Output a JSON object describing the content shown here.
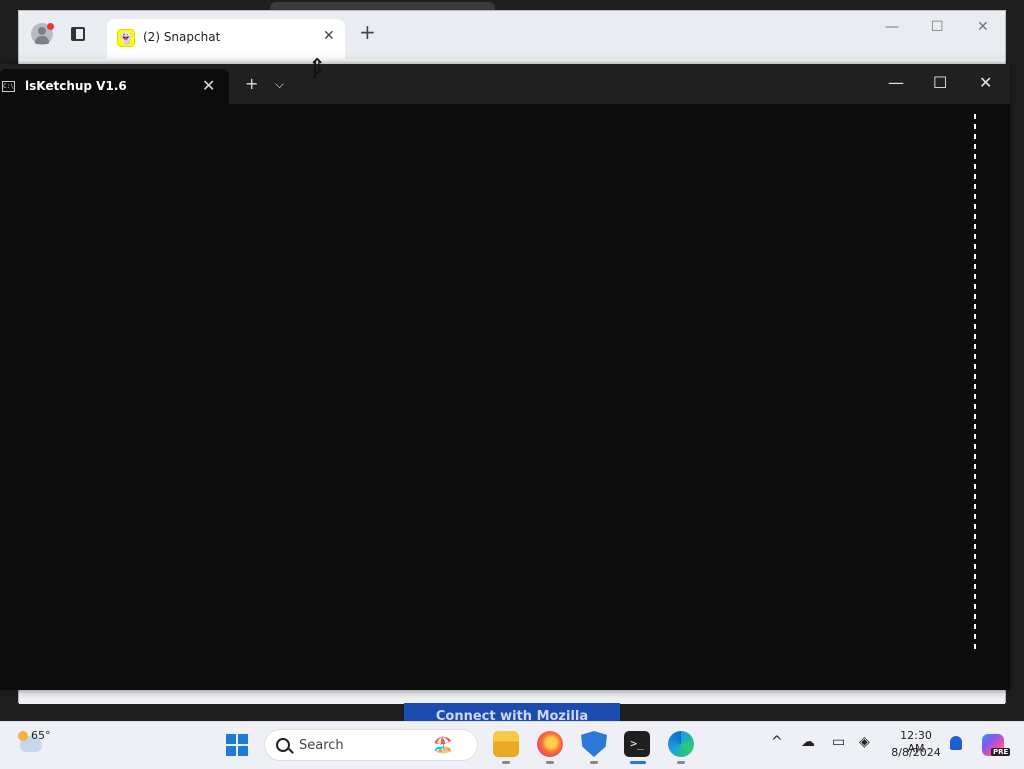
{
  "browser": {
    "tab_title": "(2) Snapchat",
    "tab_close": "✕",
    "new_tab": "+",
    "minimize": "—",
    "maximize": "☐",
    "close": "✕",
    "bottom_button": "Connect with Mozilla"
  },
  "terminal": {
    "tab_title": "lsKetchup V1.6",
    "tab_close": "✕",
    "new_tab": "+",
    "dropdown": "⌵",
    "icon_text": "C:\\",
    "minimize": "—",
    "maximize": "☐",
    "close": "✕"
  },
  "taskbar": {
    "weather_temp": "65°",
    "search_placeholder": "Search",
    "clock_time": "12:30 AM",
    "clock_date": "8/8/2024",
    "tray_chevron": "^",
    "pre_badge": "PRE",
    "terminal_glyph": ">_",
    "apps": [
      "file-explorer",
      "firefox",
      "windows-security",
      "terminal",
      "edge"
    ]
  },
  "colors": {
    "terminal_bg": "#0c0c0c",
    "terminal_titlebar": "#202020",
    "taskbar_bg": "#eef0f5",
    "accent": "#1d7bd7"
  }
}
